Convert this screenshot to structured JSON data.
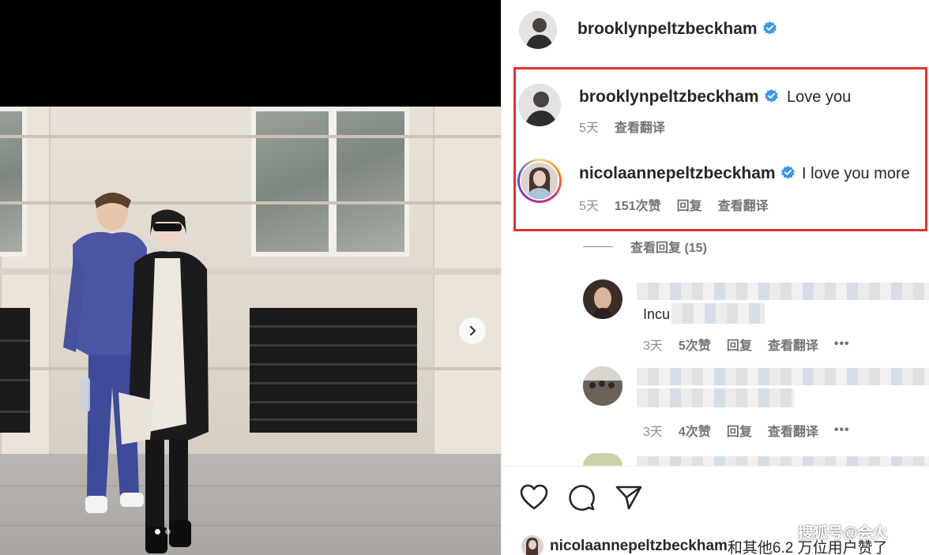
{
  "post": {
    "author": "brooklynpeltzbeckham",
    "avatar_icon": "profile-photo"
  },
  "comments": [
    {
      "user": "brooklynpeltzbeckham",
      "verified": true,
      "text": "Love you",
      "time": "5天",
      "translate": "查看翻译"
    },
    {
      "user": "nicolaannepeltzbeckham",
      "verified": true,
      "text": "I love you more",
      "time": "5天",
      "likes": "151次赞",
      "reply": "回复",
      "translate": "查看翻译"
    }
  ],
  "view_replies": "查看回复 (15)",
  "replies": [
    {
      "time": "3天",
      "likes": "5次赞",
      "reply": "回复",
      "translate": "查看翻译",
      "more": "•••",
      "partial_text": "Incu"
    },
    {
      "time": "3天",
      "likes": "4次赞",
      "reply": "回复",
      "translate": "查看翻译",
      "more": "•••"
    }
  ],
  "liked_by": {
    "user": "nicolaannepeltzbeckham",
    "suffix": "和其他6.2 万位用户赞了"
  },
  "watermark": "搜狐号@会火",
  "colors": {
    "highlight": "#e5322d",
    "verified": "#3897f0"
  }
}
